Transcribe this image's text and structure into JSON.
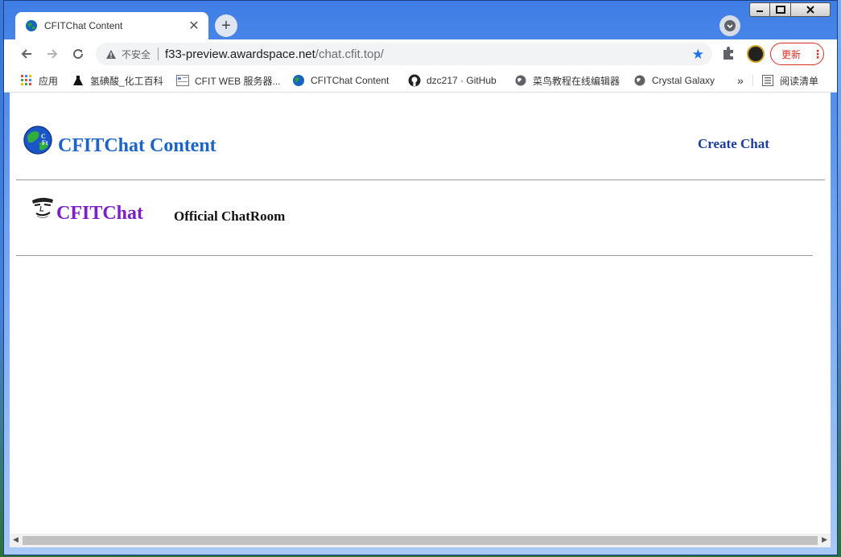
{
  "tab": {
    "title": "CFITChat Content"
  },
  "address_bar": {
    "security_label": "不安全",
    "host": "f33-preview.awardspace.net",
    "path": "/chat.cfit.top/"
  },
  "toolbar": {
    "update_label": "更新"
  },
  "bookmarks": [
    {
      "label": "应用",
      "icon": "apps-grid-icon"
    },
    {
      "label": "氢碘酸_化工百科",
      "icon": "flask-icon"
    },
    {
      "label": "CFIT WEB 服务器...",
      "icon": "page-icon"
    },
    {
      "label": "CFITChat Content",
      "icon": "globe-icon"
    },
    {
      "label": "dzc217 · GitHub",
      "icon": "github-icon"
    },
    {
      "label": "菜鸟教程在线编辑器",
      "icon": "globe-icon"
    },
    {
      "label": "Crystal Galaxy",
      "icon": "globe-icon"
    }
  ],
  "bookmarks_overflow": "»",
  "reading_list": {
    "label": "阅读清单"
  },
  "page": {
    "site_title": "CFITChat Content",
    "create_chat_label": "Create Chat",
    "chats": [
      {
        "name": "CFITChat",
        "description": "Official ChatRoom"
      }
    ]
  },
  "colors": {
    "site_title": "#1c64c8",
    "chat_name": "#7b1fc8",
    "create_link": "#1a3c9c"
  }
}
